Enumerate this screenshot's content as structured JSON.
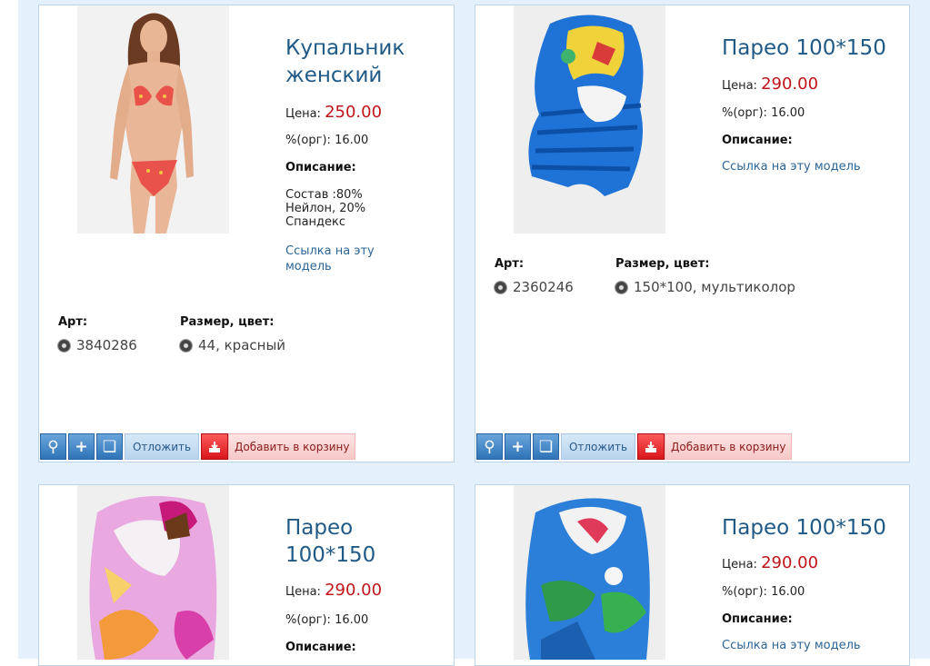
{
  "labels": {
    "price": "Цена:",
    "org": "%(орг):",
    "description": "Описание:",
    "link": "Ссылка на эту модель",
    "art": "Арт:",
    "size": "Размер, цвет:",
    "defer": "Отложить",
    "add_to_cart": "Добавить в корзину"
  },
  "products": [
    {
      "title": "Купальник женский",
      "price": "250.00",
      "org": "16.00",
      "description": "Состав :80% Нейлон, 20% Спандекс",
      "art": "3840286",
      "size": "44, красный"
    },
    {
      "title": "Парео 100*150",
      "price": "290.00",
      "org": "16.00",
      "description": "",
      "art": "2360246",
      "size": "150*100, мультиколор"
    },
    {
      "title": "Парео 100*150",
      "price": "290.00",
      "org": "16.00",
      "description": ""
    },
    {
      "title": "Парео 100*150",
      "price": "290.00",
      "org": "16.00",
      "description": ""
    }
  ],
  "colors": {
    "title": "#1f5a86",
    "price": "#c0141b",
    "link": "#2a6496",
    "background": "#e4f0fb"
  },
  "icons": [
    "zoom-icon",
    "plus-icon",
    "compare-icon",
    "cart-add-icon",
    "radio-bullet-icon"
  ]
}
